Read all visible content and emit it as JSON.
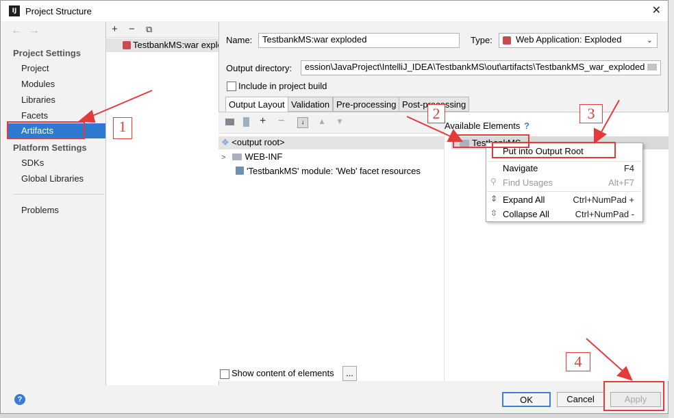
{
  "window": {
    "title": "Project Structure",
    "app_icon": "IJ",
    "close": "✕"
  },
  "nav": {
    "back": "←",
    "forward": "→"
  },
  "sidebar": {
    "project_settings_heading": "Project Settings",
    "project_items": [
      "Project",
      "Modules",
      "Libraries",
      "Facets",
      "Artifacts"
    ],
    "selected": "Artifacts",
    "platform_settings_heading": "Platform Settings",
    "platform_items": [
      "SDKs",
      "Global Libraries"
    ],
    "problems": "Problems"
  },
  "artifacts_list": {
    "add": "+",
    "remove": "−",
    "copy": "⧉",
    "item": "TestbankMS:war exploded"
  },
  "form": {
    "name_label": "Name:",
    "name_value": "TestbankMS:war exploded",
    "type_label": "Type:",
    "type_value": "Web Application: Exploded",
    "output_dir_label": "Output directory:",
    "output_dir_value": "ession\\JavaProject\\IntelliJ_IDEA\\TestbankMS\\out\\artifacts\\TestbankMS_war_exploded",
    "include_label": "Include in project build"
  },
  "tabs": [
    "Output Layout",
    "Validation",
    "Pre-processing",
    "Post-processing"
  ],
  "layout_tree": {
    "root": "<output root>",
    "webinf": "WEB-INF",
    "facet": "'TestbankMS' module: 'Web' facet resources"
  },
  "available": {
    "heading": "Available Elements",
    "help": "?",
    "item": "TestbankMS"
  },
  "context_menu": {
    "put_into_root": "Put into Output Root",
    "navigate": "Navigate",
    "navigate_sc": "F4",
    "find_usages": "Find Usages",
    "find_usages_sc": "Alt+F7",
    "expand_all": "Expand All",
    "expand_all_sc": "Ctrl+NumPad +",
    "collapse_all": "Collapse All",
    "collapse_all_sc": "Ctrl+NumPad -"
  },
  "bottom": {
    "show_content": "Show content of elements",
    "ellipsis": "...",
    "ok": "OK",
    "cancel": "Cancel",
    "apply": "Apply"
  },
  "annotations": [
    "1",
    "2",
    "3",
    "4"
  ],
  "colors": {
    "selection": "#2f7ad1",
    "annotation_red": "#e53a3a"
  }
}
